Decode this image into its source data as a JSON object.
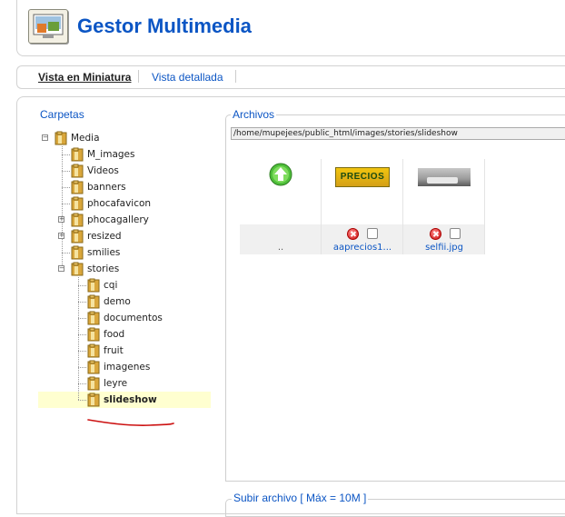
{
  "header": {
    "title": "Gestor Multimedia",
    "icon": "media-manager-icon"
  },
  "tabs": [
    {
      "label": "Vista en Miniatura",
      "active": true
    },
    {
      "label": "Vista detallada",
      "active": false
    }
  ],
  "folders": {
    "title": "Carpetas",
    "root": "Media",
    "items": [
      {
        "label": "M_images",
        "expandable": false
      },
      {
        "label": "Videos",
        "expandable": false
      },
      {
        "label": "banners",
        "expandable": false
      },
      {
        "label": "phocafavicon",
        "expandable": false
      },
      {
        "label": "phocagallery",
        "expandable": true
      },
      {
        "label": "resized",
        "expandable": true
      },
      {
        "label": "smilies",
        "expandable": false
      },
      {
        "label": "stories",
        "expandable": true,
        "expanded": true
      }
    ],
    "stories_children": [
      {
        "label": "cqi"
      },
      {
        "label": "demo"
      },
      {
        "label": "documentos"
      },
      {
        "label": "food"
      },
      {
        "label": "fruit"
      },
      {
        "label": "imagenes"
      },
      {
        "label": "leyre"
      },
      {
        "label": "slideshow",
        "selected": true
      }
    ]
  },
  "files": {
    "title": "Archivos",
    "path": "/home/mupejees/public_html/images/stories/slideshow",
    "items": [
      {
        "name": "..",
        "kind": "up"
      },
      {
        "name": "aaprecios1...",
        "kind": "image",
        "thumb_text": "PRECIOS"
      },
      {
        "name": "selfii.jpg",
        "kind": "image"
      }
    ]
  },
  "upload": {
    "title": "Subir archivo [ Máx = 10M ]"
  },
  "colors": {
    "accent": "#0b55c4",
    "selected_bg": "#ffffd0",
    "annotation": "#cc1111"
  }
}
